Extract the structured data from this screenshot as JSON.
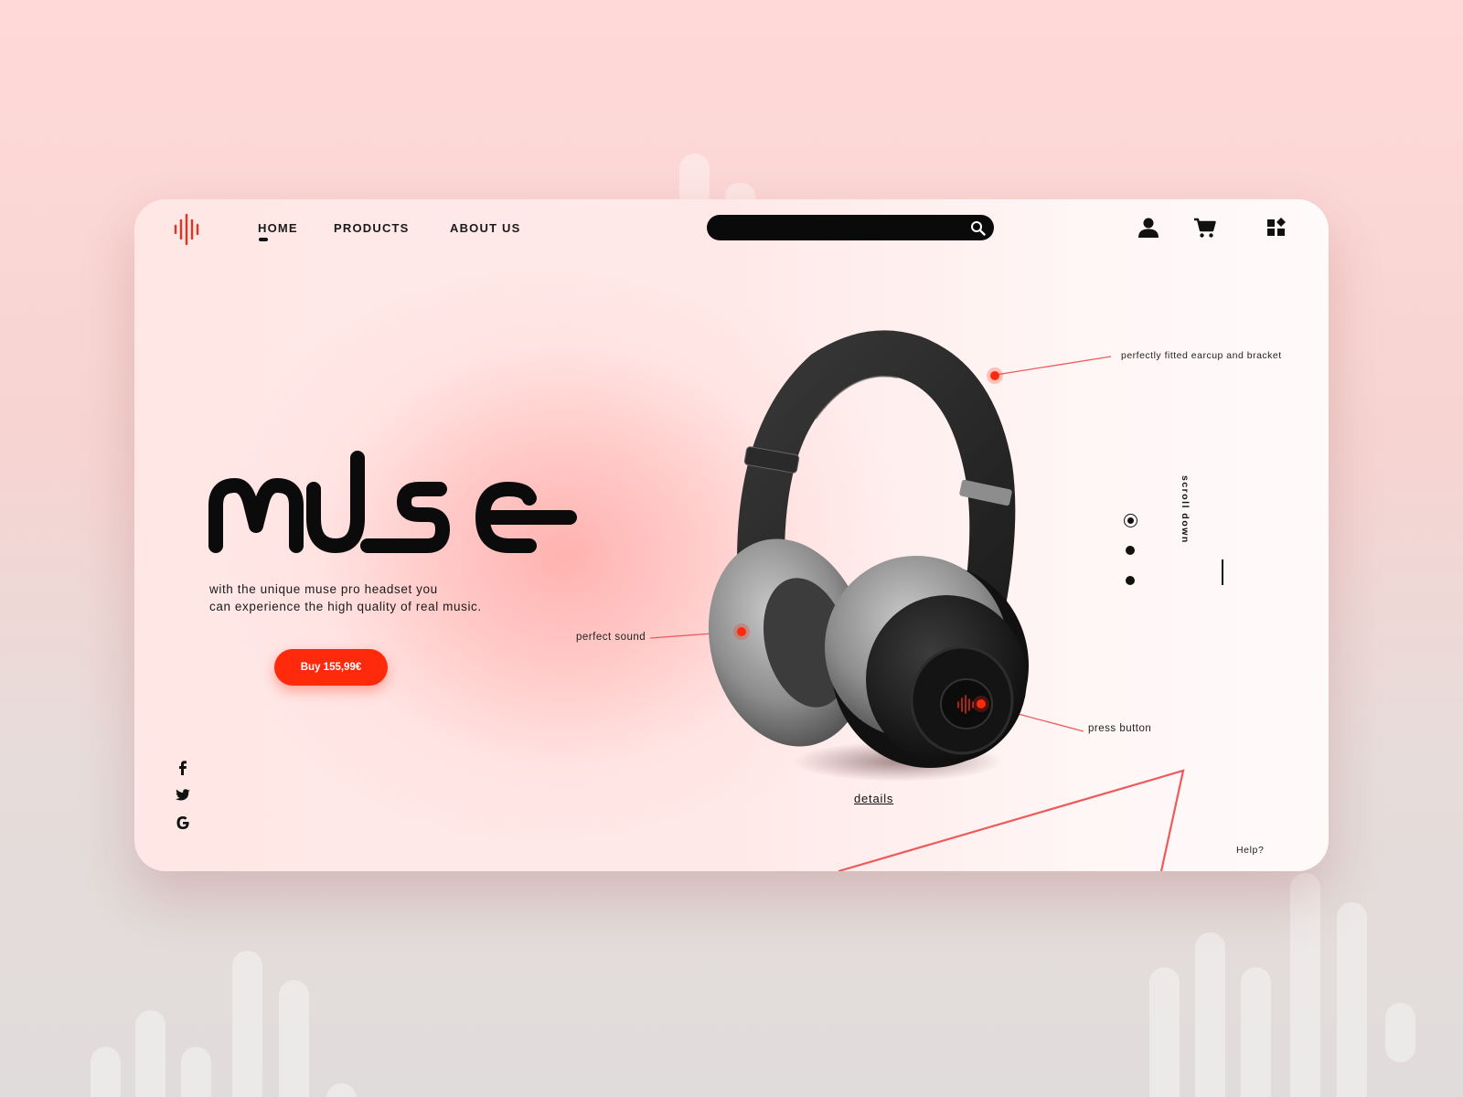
{
  "nav": {
    "logo_icon": "sound-wave-logo-icon",
    "items": [
      {
        "label": "HOME",
        "active": true
      },
      {
        "label": "PRODUCTS",
        "active": false
      },
      {
        "label": "ABOUT US",
        "active": false
      }
    ]
  },
  "search": {
    "value": "",
    "placeholder": "",
    "icon": "search-icon"
  },
  "header_icons": [
    "user-icon",
    "cart-icon",
    "apps-grid-icon"
  ],
  "hero": {
    "brand_name": "MUSE",
    "tagline_line1": "with the unique muse pro headset you",
    "tagline_line2": "can experience the high quality of real music.",
    "buy_button": "Buy 155,99€"
  },
  "social": [
    "facebook-icon",
    "twitter-icon",
    "google-icon"
  ],
  "product": {
    "image": "black-over-ear-headphones",
    "callouts": {
      "earcup_bracket": "perfectly fitted earcup and bracket",
      "sound": "perfect sound",
      "press_button": "press button"
    },
    "details_link": "details"
  },
  "pager": {
    "total": 3,
    "active_index": 0
  },
  "scroll_down": "scroll down",
  "help": "Help?",
  "colors": {
    "accent": "#ff2a0c",
    "callout_line": "#ee5a5a",
    "dark": "#111111",
    "background_pink": "#ffd9d7"
  }
}
